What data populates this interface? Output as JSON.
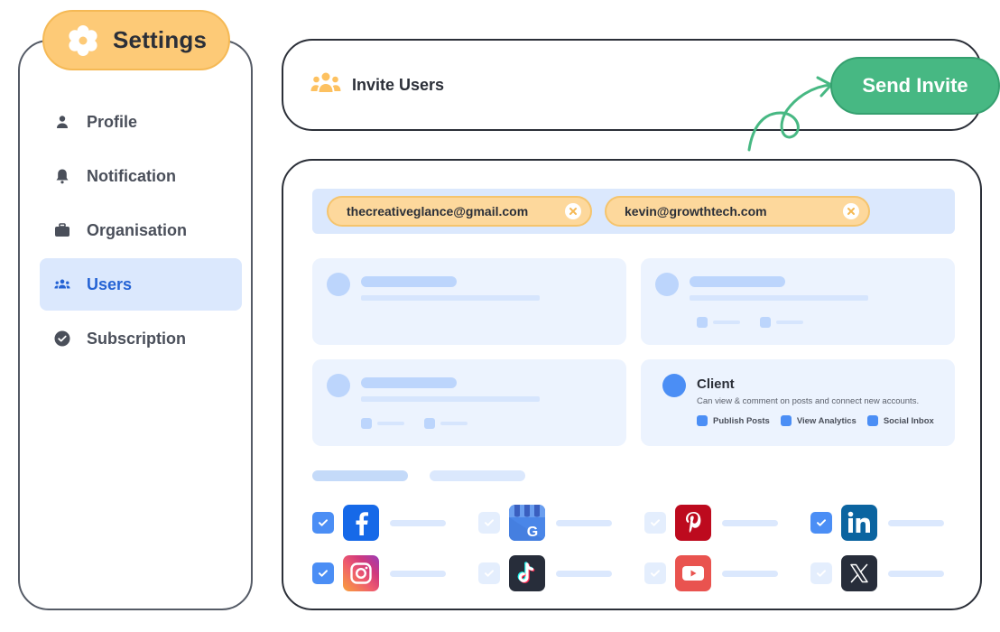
{
  "sidebar": {
    "title": "Settings",
    "title_icon": "gear-icon",
    "items": [
      {
        "label": "Profile",
        "icon": "user-icon",
        "active": false
      },
      {
        "label": "Notification",
        "icon": "bell-icon",
        "active": false
      },
      {
        "label": "Organisation",
        "icon": "briefcase-icon",
        "active": false
      },
      {
        "label": "Users",
        "icon": "users-icon",
        "active": true
      },
      {
        "label": "Subscription",
        "icon": "check-circle-icon",
        "active": false
      }
    ]
  },
  "header": {
    "title": "Invite Users",
    "icon": "users-icon",
    "send_button": "Send Invite"
  },
  "invite": {
    "emails": [
      "thecreativeglance@gmail.com",
      "kevin@growthtech.com"
    ]
  },
  "roles": {
    "client": {
      "title": "Client",
      "description": "Can view & comment on posts and connect new accounts.",
      "permissions": [
        "Publish Posts",
        "View Analytics",
        "Social Inbox"
      ]
    }
  },
  "socials": [
    {
      "name": "facebook",
      "checked": true
    },
    {
      "name": "google-business",
      "checked": false
    },
    {
      "name": "pinterest",
      "checked": false
    },
    {
      "name": "linkedin",
      "checked": true
    },
    {
      "name": "instagram",
      "checked": true
    },
    {
      "name": "tiktok",
      "checked": false
    },
    {
      "name": "youtube",
      "checked": false
    },
    {
      "name": "x",
      "checked": false
    }
  ],
  "colors": {
    "accent_yellow": "#fdca77",
    "accent_green": "#47b883",
    "accent_blue": "#4b8ef5",
    "active_nav_bg": "#dbe8fd",
    "active_nav_text": "#2563d4"
  }
}
